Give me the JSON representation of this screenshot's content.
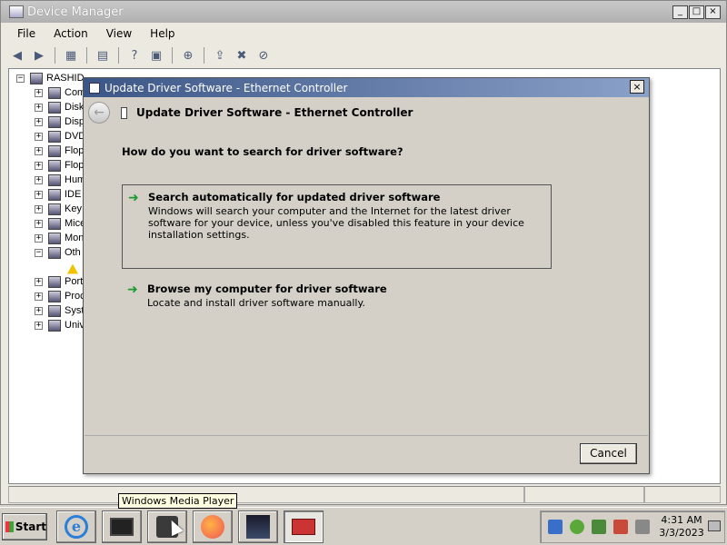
{
  "dm_window": {
    "title": "Device Manager",
    "window_buttons": [
      "_",
      "□",
      "×"
    ]
  },
  "menu": {
    "items": [
      "File",
      "Action",
      "View",
      "Help"
    ]
  },
  "toolbar": {
    "icons": [
      "back-icon",
      "forward-icon",
      "properties-pane-icon",
      "list-icon",
      "help-icon",
      "properties-icon",
      "scan-hardware-icon",
      "update-driver-icon",
      "uninstall-icon",
      "disable-icon"
    ]
  },
  "tree": {
    "root": "RASHID",
    "items": [
      {
        "label": "Com",
        "toggle": "+"
      },
      {
        "label": "Disk",
        "toggle": "+"
      },
      {
        "label": "Disp",
        "toggle": "+"
      },
      {
        "label": "DVD",
        "toggle": "+"
      },
      {
        "label": "Flop",
        "toggle": "+"
      },
      {
        "label": "Flop",
        "toggle": "+"
      },
      {
        "label": "Hum",
        "toggle": "+"
      },
      {
        "label": "IDE",
        "toggle": "+"
      },
      {
        "label": "Key",
        "toggle": "+"
      },
      {
        "label": "Mice",
        "toggle": "+"
      },
      {
        "label": "Mon",
        "toggle": "+"
      },
      {
        "label": "Oth",
        "toggle": "−"
      },
      {
        "label": "",
        "toggle": ""
      },
      {
        "label": "Port",
        "toggle": "+"
      },
      {
        "label": "Proc",
        "toggle": "+"
      },
      {
        "label": "Syst",
        "toggle": "+"
      },
      {
        "label": "Univ",
        "toggle": "+"
      }
    ]
  },
  "dialog": {
    "title": "Update Driver Software - Ethernet Controller",
    "header_title": "Update Driver Software - Ethernet Controller",
    "close_label": "×",
    "back_label": "←",
    "question": "How do you want to search for driver software?",
    "options": [
      {
        "arrow": "➜",
        "title": "Search automatically for updated driver software",
        "description": "Windows will search your computer and the Internet for the latest driver software for your device, unless you've disabled this feature in your device installation settings."
      },
      {
        "arrow": "➜",
        "title": "Browse my computer for driver software",
        "description": "Locate and install driver software manually."
      }
    ],
    "cancel_label": "Cancel"
  },
  "taskbar": {
    "start_label": "Start",
    "tooltip": "Windows Media Player",
    "ie_glyph": "e",
    "apps": [
      "internet-explorer-icon",
      "monitor-app-icon",
      "windows-media-player-icon",
      "firefox-icon",
      "dark-app-icon",
      "toolbox-icon"
    ],
    "tray_icons": [
      "security-icon",
      "utorrent-icon",
      "network-icon",
      "power-icon",
      "volume-muted-icon"
    ],
    "clock_time": "4:31 AM",
    "clock_date": "3/3/2023"
  },
  "colors": {
    "dialog_title_bar": "#3c5687",
    "option_arrow": "#1d9b2f",
    "tooltip_bg": "#ffffe1"
  }
}
